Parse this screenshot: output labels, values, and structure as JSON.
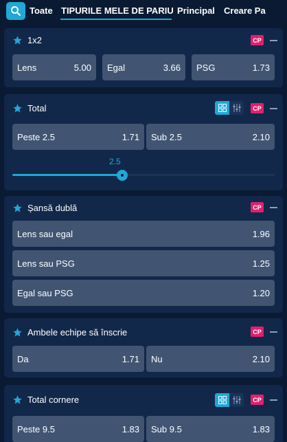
{
  "tabs": {
    "items": [
      "Toate",
      "TIPURILE MELE DE PARIU",
      "Principal",
      "Creare Pa"
    ],
    "active_index": 1
  },
  "icons": {
    "search": "search-icon",
    "star": "star-icon",
    "grid_view": "grid-view-icon",
    "list_view": "sliders-icon",
    "collapse": "minus-icon"
  },
  "colors": {
    "accent": "#1fa8d8",
    "badge": "#e0206f",
    "background": "#0b1a33",
    "card": "#12284a",
    "odd_button": "#415573"
  },
  "markets": {
    "m1x2": {
      "title": "1x2",
      "badge": "CP",
      "odds": [
        {
          "label": "Lens",
          "value": "5.00"
        },
        {
          "label": "Egal",
          "value": "3.66"
        },
        {
          "label": "PSG",
          "value": "1.73"
        }
      ]
    },
    "total": {
      "title": "Total",
      "badge": "CP",
      "odds": [
        {
          "label": "Peste 2.5",
          "value": "1.71"
        },
        {
          "label": "Sub 2.5",
          "value": "2.10"
        }
      ],
      "slider_value": "2.5",
      "slider_fraction": 0.42
    },
    "double": {
      "title": "Șansă dublă",
      "badge": "CP",
      "odds": [
        {
          "label": "Lens sau egal",
          "value": "1.96"
        },
        {
          "label": "Lens sau PSG",
          "value": "1.25"
        },
        {
          "label": "Egal sau PSG",
          "value": "1.20"
        }
      ]
    },
    "btts": {
      "title": "Ambele echipe să înscrie",
      "badge": "CP",
      "odds": [
        {
          "label": "Da",
          "value": "1.71"
        },
        {
          "label": "Nu",
          "value": "2.10"
        }
      ]
    },
    "corners": {
      "title": "Total cornere",
      "badge": "CP",
      "odds": [
        {
          "label": "Peste 9.5",
          "value": "1.83"
        },
        {
          "label": "Sub 9.5",
          "value": "1.83"
        }
      ]
    }
  }
}
